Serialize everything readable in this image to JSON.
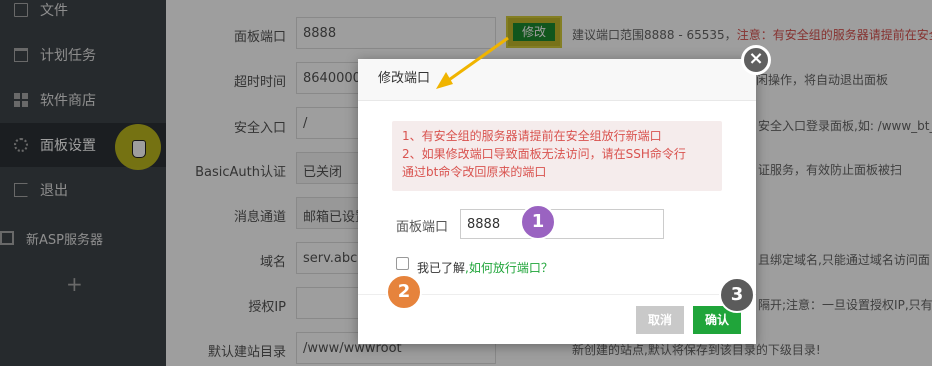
{
  "sidebar": {
    "items": [
      {
        "label": "文件",
        "icon": "file-icon"
      },
      {
        "label": "计划任务",
        "icon": "calendar-icon"
      },
      {
        "label": "软件商店",
        "icon": "grid-icon"
      },
      {
        "label": "面板设置",
        "icon": "gear-icon"
      },
      {
        "label": "退出",
        "icon": "exit-icon"
      },
      {
        "label": "新ASP服务器",
        "icon": "monitor-icon"
      }
    ],
    "add": "+"
  },
  "form": {
    "rows": [
      {
        "label": "面板端口",
        "value": "8888"
      },
      {
        "label": "超时时间",
        "value": "8640000"
      },
      {
        "label": "安全入口",
        "value": "/"
      },
      {
        "label": "BasicAuth认证",
        "value": "已关闭"
      },
      {
        "label": "消息通道",
        "value": "邮箱已设置"
      },
      {
        "label": "域名",
        "value": "serv.abcm"
      },
      {
        "label": "授权IP",
        "value": ""
      },
      {
        "label": "默认建站目录",
        "value": "/www/wwwroot"
      }
    ],
    "modify_button": "修改",
    "hints": {
      "port_prefix": "建议端口范围8888 - 65535，",
      "port_red": "注意：有安全组的服务器请提前在安全",
      "timeout": "闲操作，将自动退出面板",
      "entry": "安全入口登录面板,如: /www_bt_",
      "auth": "证服务，有效防止面板被扫",
      "domain": "且绑定域名,只能通过域名访问面",
      "ip": "隔开;注意：一旦设置授权IP,只有",
      "dir": "新创建的站点,默认将保存到该目录的下级目录!"
    }
  },
  "modal": {
    "title": "修改端口",
    "close": "×",
    "notice_line1": "1、有安全组的服务器请提前在安全组放行新端口",
    "notice_line2": "2、如果修改端口导致面板无法访问，请在SSH命令行",
    "notice_line3": "通过bt命令改回原来的端口",
    "port_label": "面板端口",
    "port_value": "8888",
    "checkbox_text": "我已了解",
    "checkbox_link": ",如何放行端口？",
    "cancel": "取消",
    "confirm": "确认"
  },
  "markers": [
    "1",
    "2",
    "3"
  ],
  "colors": {
    "sidebar_bg": "#3e4449",
    "green": "#20a53a",
    "red": "#d9534f",
    "marker1": "#9a63c1",
    "marker2": "#e6833c",
    "marker3": "#5b5b5b",
    "highlight": "#c5c11e"
  }
}
